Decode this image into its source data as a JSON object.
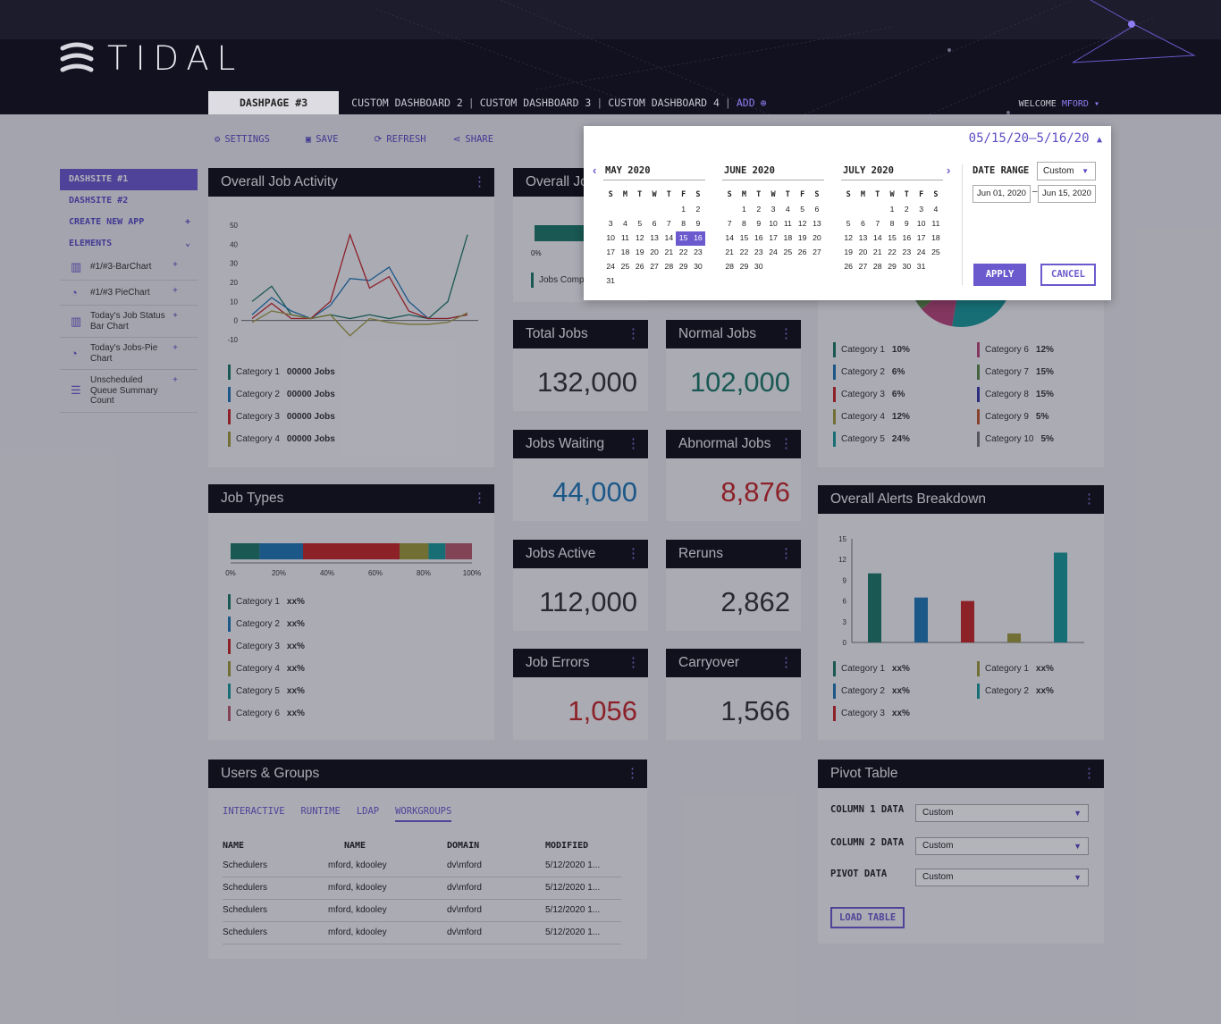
{
  "brand": "TIDAL",
  "tabs": {
    "active": "DASHPAGE #3",
    "items": [
      "CUSTOM DASHBOARD 2",
      "CUSTOM DASHBOARD 3",
      "CUSTOM DASHBOARD 4"
    ],
    "sep": "|",
    "add": "ADD"
  },
  "welcome": {
    "prefix": "WELCOME",
    "user": "MFORD"
  },
  "toolbar": {
    "settings": "SETTINGS",
    "save": "SAVE",
    "refresh": "REFRESH",
    "share": "SHARE"
  },
  "sidebar": {
    "items": [
      "DASHSITE #1",
      "DASHSITE #2",
      "CREATE NEW APP",
      "ELEMENTS"
    ],
    "elements": [
      {
        "label": "#1/#3-BarChart",
        "icon": "bar-chart-icon"
      },
      {
        "label": "#1/#3 PieChart",
        "icon": "pie-chart-icon"
      },
      {
        "label": "Today's Job Status Bar Chart",
        "icon": "bar-chart-icon"
      },
      {
        "label": "Today's Jobs-Pie Chart",
        "icon": "pie-chart-icon"
      },
      {
        "label": "Unscheduled Queue Summary Count",
        "icon": "list-icon"
      }
    ]
  },
  "activity": {
    "title": "Overall Job Activity",
    "legend": [
      {
        "name": "Category 1",
        "value": "00000 Jobs",
        "color": "#1d7a67"
      },
      {
        "name": "Category 2",
        "value": "00000 Jobs",
        "color": "#1f78b4"
      },
      {
        "name": "Category 3",
        "value": "00000 Jobs",
        "color": "#c62828"
      },
      {
        "name": "Category 4",
        "value": "00000 Jobs",
        "color": "#9e9b3a"
      }
    ]
  },
  "jobtypes": {
    "title": "Job Types",
    "legend": [
      {
        "name": "Category 1",
        "value": "xx%",
        "color": "#1d7a67"
      },
      {
        "name": "Category 2",
        "value": "xx%",
        "color": "#1f78b4"
      },
      {
        "name": "Category 3",
        "value": "xx%",
        "color": "#c62828"
      },
      {
        "name": "Category 4",
        "value": "xx%",
        "color": "#9e9b3a"
      },
      {
        "name": "Category 5",
        "value": "xx%",
        "color": "#1a9a9a"
      },
      {
        "name": "Category 6",
        "value": "xx%",
        "color": "#b85a6e"
      }
    ]
  },
  "overall_jobs": {
    "title": "Overall Jobs",
    "legend": "Jobs Comp"
  },
  "kpis": [
    {
      "title": "Total Jobs",
      "value": "132,000",
      "color": "#333"
    },
    {
      "title": "Normal Jobs",
      "value": "102,000",
      "color": "#1d7a67"
    },
    {
      "title": "Jobs Waiting",
      "value": "44,000",
      "color": "#1f78b4"
    },
    {
      "title": "Abnormal Jobs",
      "value": "8,876",
      "color": "#c62828"
    },
    {
      "title": "Jobs Active",
      "value": "112,000",
      "color": "#333"
    },
    {
      "title": "Reruns",
      "value": "2,862",
      "color": "#333"
    },
    {
      "title": "Job Errors",
      "value": "1,056",
      "color": "#c62828"
    },
    {
      "title": "Carryover",
      "value": "1,566",
      "color": "#333"
    }
  ],
  "pie": {
    "legend": [
      {
        "name": "Category 1",
        "value": "10%",
        "color": "#1d7a67"
      },
      {
        "name": "Category 2",
        "value": "6%",
        "color": "#1f78b4"
      },
      {
        "name": "Category 3",
        "value": "6%",
        "color": "#c62828"
      },
      {
        "name": "Category 4",
        "value": "12%",
        "color": "#9e9b3a"
      },
      {
        "name": "Category 5",
        "value": "24%",
        "color": "#1a9a9a"
      },
      {
        "name": "Category 6",
        "value": "12%",
        "color": "#b8487a"
      },
      {
        "name": "Category 7",
        "value": "15%",
        "color": "#5c8a4a"
      },
      {
        "name": "Category 8",
        "value": "15%",
        "color": "#3a3aa8"
      },
      {
        "name": "Category 9",
        "value": "5%",
        "color": "#c0572f"
      },
      {
        "name": "Category 10",
        "value": "5%",
        "color": "#777777"
      }
    ]
  },
  "alerts": {
    "title": "Overall Alerts Breakdown",
    "legend": [
      {
        "name": "Category 1",
        "value": "xx%",
        "color": "#1d7a67"
      },
      {
        "name": "Category 2",
        "value": "xx%",
        "color": "#1f78b4"
      },
      {
        "name": "Category 3",
        "value": "xx%",
        "color": "#c62828"
      },
      {
        "name": "Category 1",
        "value": "xx%",
        "color": "#9e9b3a"
      },
      {
        "name": "Category 2",
        "value": "xx%",
        "color": "#1a9a9a"
      }
    ]
  },
  "users": {
    "title": "Users & Groups",
    "tabs": [
      "INTERACTIVE",
      "RUNTIME",
      "LDAP",
      "WORKGROUPS"
    ],
    "columns": [
      "NAME",
      "NAME",
      "DOMAIN",
      "MODIFIED"
    ],
    "rows": [
      [
        "Schedulers",
        "mford, kdooley",
        "dv\\mford",
        "5/12/2020 1..."
      ],
      [
        "Schedulers",
        "mford, kdooley",
        "dv\\mford",
        "5/12/2020 1..."
      ],
      [
        "Schedulers",
        "mford, kdooley",
        "dv\\mford",
        "5/12/2020 1..."
      ],
      [
        "Schedulers",
        "mford, kdooley",
        "dv\\mford",
        "5/12/2020 1..."
      ]
    ]
  },
  "pivot": {
    "title": "Pivot Table",
    "rows": [
      {
        "label": "COLUMN 1 DATA",
        "value": "Custom"
      },
      {
        "label": "COLUMN 2 DATA",
        "value": "Custom"
      },
      {
        "label": "PIVOT DATA",
        "value": "Custom"
      }
    ],
    "button": "LOAD TABLE"
  },
  "datepicker": {
    "range": "05/15/20–5/16/20",
    "months": [
      {
        "name": "MAY 2020",
        "start": 5,
        "days": 31
      },
      {
        "name": "JUNE 2020",
        "start": 1,
        "days": 30
      },
      {
        "name": "JULY 2020",
        "start": 3,
        "days": 31
      }
    ],
    "weekdays": [
      "S",
      "M",
      "T",
      "W",
      "T",
      "F",
      "S"
    ],
    "date_range_label": "DATE RANGE",
    "date_range_value": "Custom",
    "from": "Jun 01, 2020",
    "to": "Jun 15, 2020",
    "dash": "–",
    "apply": "APPLY",
    "cancel": "CANCEL"
  },
  "chart_data": [
    {
      "type": "line",
      "title": "Overall Job Activity",
      "ylim": [
        -10,
        50
      ],
      "yticks": [
        50,
        40,
        30,
        20,
        10,
        0,
        -10
      ],
      "series": [
        {
          "name": "Category 1",
          "values": [
            10,
            18,
            3,
            1,
            3,
            1,
            3,
            1,
            3,
            1,
            10,
            45
          ]
        },
        {
          "name": "Category 2",
          "values": [
            3,
            12,
            5,
            1,
            8,
            22,
            21,
            28,
            10,
            1,
            1,
            3
          ]
        },
        {
          "name": "Category 3",
          "values": [
            1,
            9,
            1,
            1,
            10,
            45,
            17,
            23,
            5,
            1,
            1,
            3
          ]
        },
        {
          "name": "Category 4",
          "values": [
            -1,
            5,
            3,
            1,
            3,
            -8,
            1,
            -1,
            -2,
            -2,
            -1,
            4
          ]
        }
      ]
    },
    {
      "type": "bar",
      "title": "Job Types",
      "stacked": true,
      "xticks": [
        "0%",
        "20%",
        "40%",
        "60%",
        "80%",
        "100%"
      ],
      "series": [
        {
          "name": "Category 1",
          "values": [
            12
          ]
        },
        {
          "name": "Category 2",
          "values": [
            18
          ]
        },
        {
          "name": "Category 3",
          "values": [
            40
          ]
        },
        {
          "name": "Category 4",
          "values": [
            12
          ]
        },
        {
          "name": "Category 5",
          "values": [
            7
          ]
        },
        {
          "name": "Category 6",
          "values": [
            11
          ]
        }
      ]
    },
    {
      "type": "bar",
      "title": "Overall Alerts Breakdown",
      "ylim": [
        0,
        15
      ],
      "yticks": [
        15,
        12,
        9,
        6,
        3,
        0
      ],
      "categories": [
        "Category 1",
        "Category 2",
        "Category 3",
        "Category 1",
        "Category 2"
      ],
      "values": [
        10,
        6.5,
        6,
        1.3,
        13
      ]
    },
    {
      "type": "pie",
      "categories": [
        "Category 1",
        "Category 2",
        "Category 3",
        "Category 4",
        "Category 5",
        "Category 6",
        "Category 7",
        "Category 8",
        "Category 9",
        "Category 10"
      ],
      "values": [
        10,
        6,
        6,
        12,
        24,
        12,
        15,
        15,
        5,
        5
      ]
    }
  ]
}
